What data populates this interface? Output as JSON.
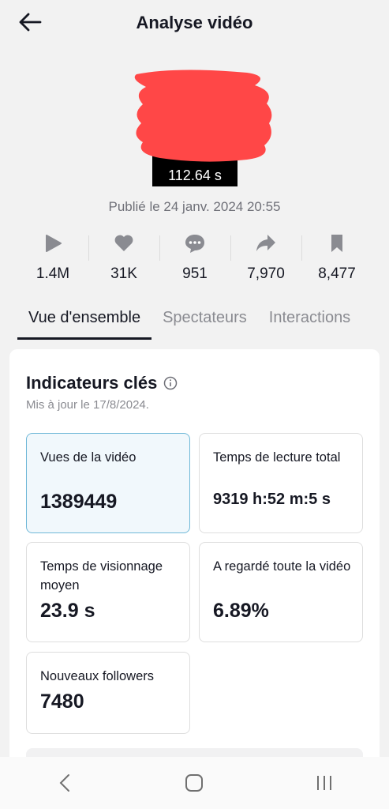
{
  "header": {
    "title": "Analyse vidéo"
  },
  "video": {
    "duration": "112.64 s",
    "published": "Publié le 24 janv. 2024 20:55"
  },
  "stats": [
    {
      "icon": "play-icon",
      "value": "1.4M"
    },
    {
      "icon": "heart-icon",
      "value": "31K"
    },
    {
      "icon": "comment-icon",
      "value": "951"
    },
    {
      "icon": "share-icon",
      "value": "7,970"
    },
    {
      "icon": "bookmark-icon",
      "value": "8,477"
    }
  ],
  "tabs": [
    {
      "label": "Vue d'ensemble",
      "active": true
    },
    {
      "label": "Spectateurs",
      "active": false
    },
    {
      "label": "Interactions",
      "active": false
    }
  ],
  "key_metrics": {
    "title": "Indicateurs clés",
    "updated": "Mis à jour le 17/8/2024.",
    "items": [
      {
        "label": "Vues de la vidéo",
        "value": "1389449"
      },
      {
        "label": "Temps de lecture total",
        "value": "9319 h:52 m:5 s"
      },
      {
        "label": "Temps de visionnage moyen",
        "value": "23.9 s"
      },
      {
        "label": "A regardé toute la vidéo",
        "value": "6.89%"
      },
      {
        "label": "Nouveaux followers",
        "value": "7480"
      }
    ]
  },
  "colors": {
    "redaction": "#ff4747",
    "highlight_border": "#6fb8d8",
    "highlight_bg": "#f1f8fc"
  }
}
